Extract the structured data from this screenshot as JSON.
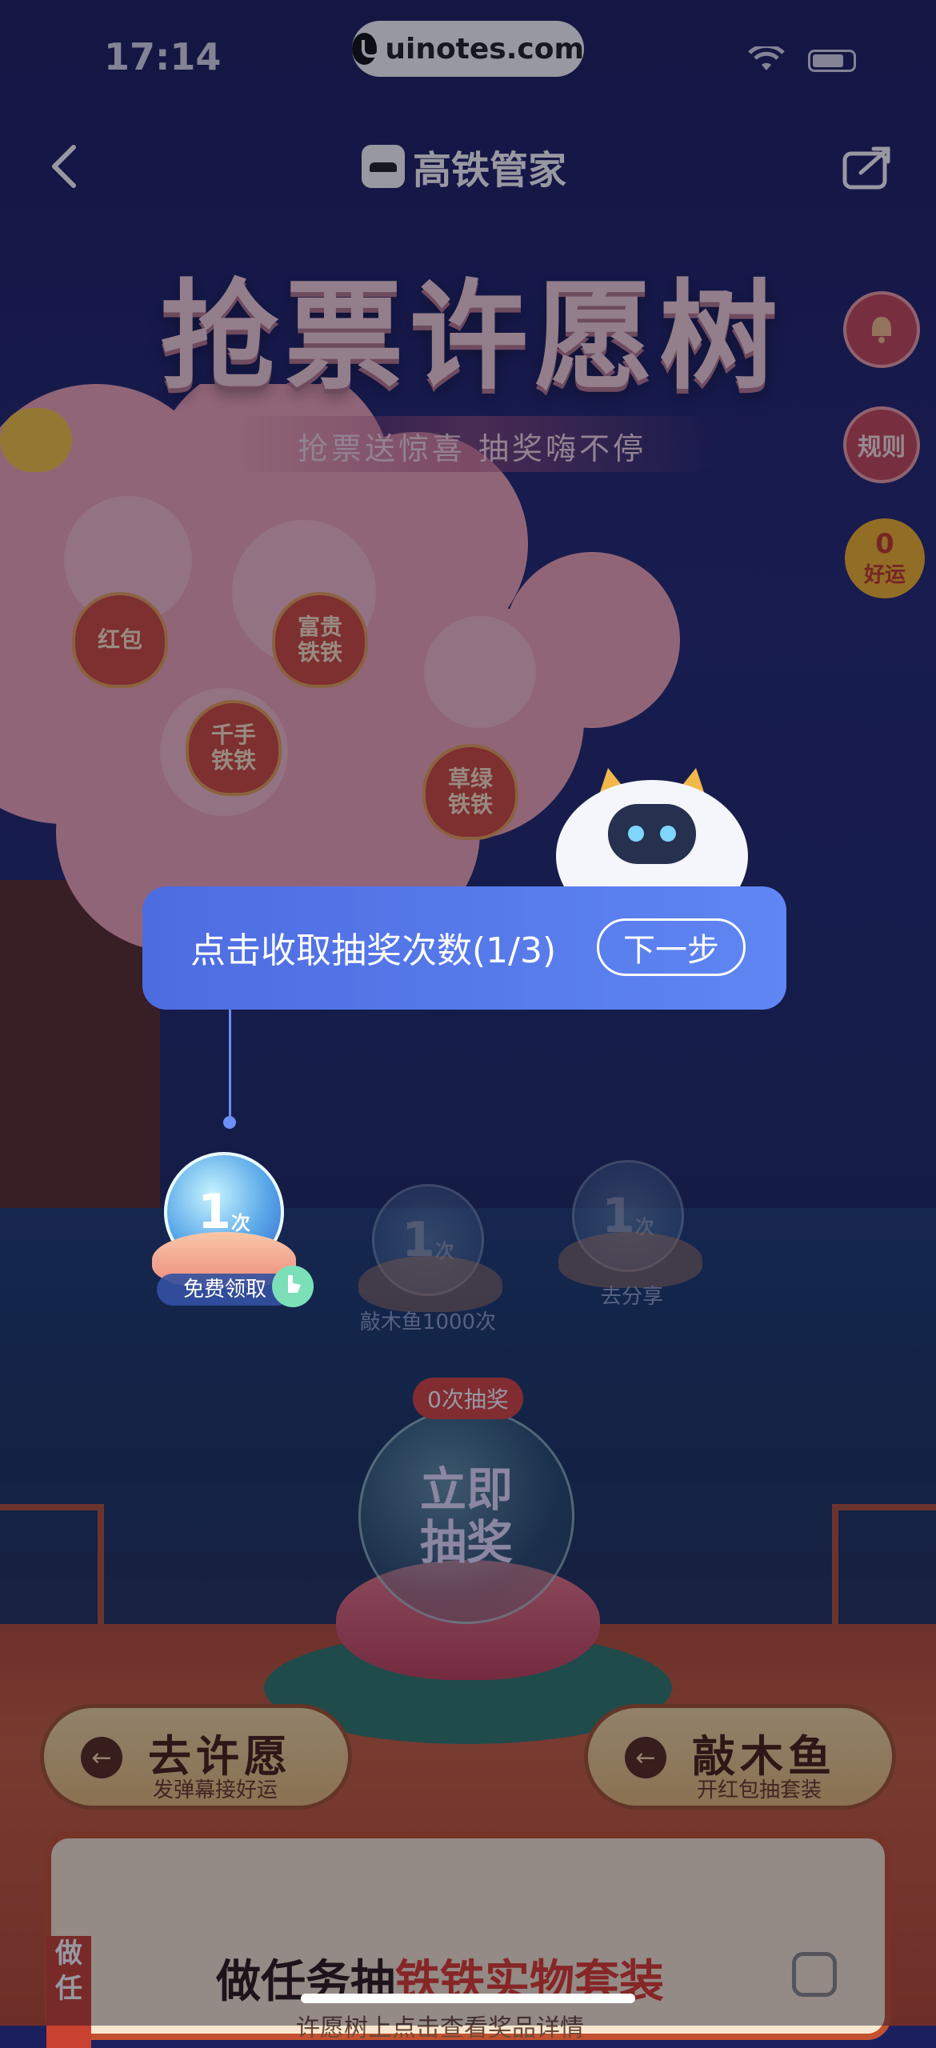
{
  "status_bar": {
    "time": "17:14"
  },
  "watermark": {
    "text": "uinotes.com"
  },
  "nav": {
    "title": "高铁管家",
    "back_icon": "chevron-left-icon",
    "share_icon": "share-icon"
  },
  "hero": {
    "title": "抢票许愿树",
    "subtitle": "抢票送惊喜  抽奖嗨不停"
  },
  "side_buttons": {
    "rules": "规则",
    "luck_count": "0",
    "luck_label": "好运"
  },
  "tree_bags": [
    "红包",
    "富贵\n铁铁",
    "千手\n铁铁",
    "草绿\n铁铁"
  ],
  "tooltip": {
    "text": "点击收取抽奖次数(1/3)",
    "next_label": "下一步"
  },
  "lotus_rewards": [
    {
      "count": "1",
      "unit": "次",
      "label": "免费领取"
    },
    {
      "count": "1",
      "unit": "次",
      "label": "敲木鱼1000次"
    },
    {
      "count": "1",
      "unit": "次",
      "label": "去分享"
    }
  ],
  "draw": {
    "badge": "0次抽奖",
    "button_label": "立即\n抽奖"
  },
  "actions": [
    {
      "title": "去许愿",
      "subtitle": "发弹幕接好运"
    },
    {
      "title": "敲木鱼",
      "subtitle": "开红包抽套装"
    }
  ],
  "task_card": {
    "tab_label": "做任",
    "title_prefix": "做任务抽",
    "title_highlight": "铁铁实物套装",
    "subtitle": "许愿树上点击查看奖品详情"
  },
  "colors": {
    "tooltip": "#5f86f3",
    "accent_red": "#d8453e",
    "deck": "#c8603e"
  }
}
